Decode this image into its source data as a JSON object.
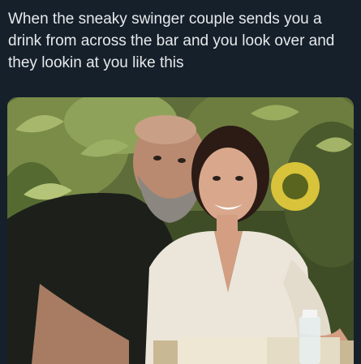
{
  "post": {
    "caption": "When the sneaky swinger couple sends you a drink from across the bar and you look over and they lookin at you like this"
  },
  "colors": {
    "background": "#15202b",
    "caption_text": "#e7e9ea"
  }
}
